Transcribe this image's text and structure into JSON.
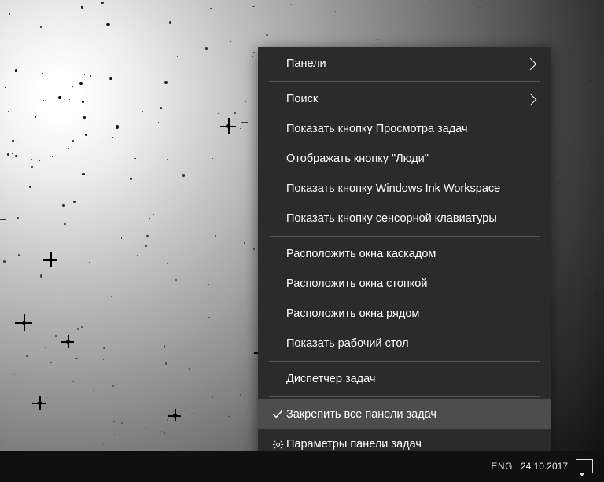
{
  "menu": {
    "groups": [
      [
        {
          "label": "Панели",
          "submenu": true
        }
      ],
      [
        {
          "label": "Поиск",
          "submenu": true
        },
        {
          "label": "Показать кнопку Просмотра задач"
        },
        {
          "label": "Отображать кнопку \"Люди\""
        },
        {
          "label": "Показать кнопку Windows Ink Workspace"
        },
        {
          "label": "Показать кнопку сенсорной клавиатуры"
        }
      ],
      [
        {
          "label": "Расположить окна каскадом"
        },
        {
          "label": "Расположить окна стопкой"
        },
        {
          "label": "Расположить окна рядом"
        },
        {
          "label": "Показать рабочий стол"
        }
      ],
      [
        {
          "label": "Диспетчер задач"
        }
      ],
      [
        {
          "label": "Закрепить все панели задач",
          "icon": "check",
          "hover": true
        },
        {
          "label": "Параметры панели задач",
          "icon": "gear"
        }
      ]
    ]
  },
  "taskbar": {
    "lang": "ENG",
    "date": "24.10.2017"
  }
}
